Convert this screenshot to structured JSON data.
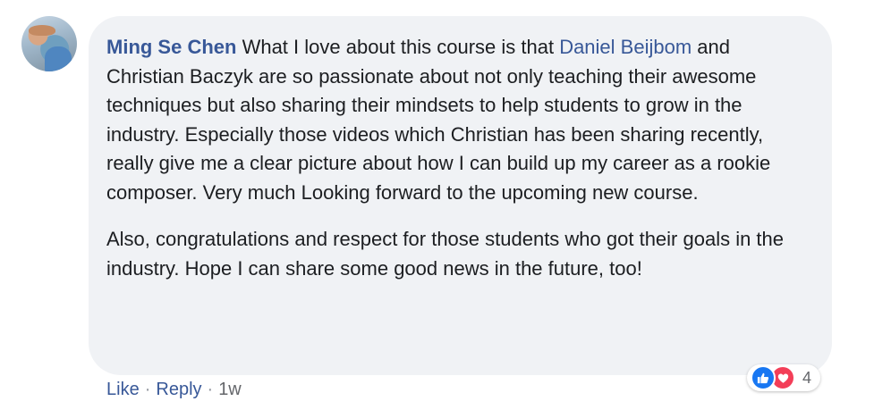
{
  "comment": {
    "author": "Ming Se Chen",
    "para1_intro": " What I love about this course is that ",
    "mention": "Daniel Beijbom",
    "para1_rest": " and Christian Baczyk are so passionate about not only teaching their awesome techniques but also sharing their mindsets to help students to grow in the industry. Especially those videos which Christian has been sharing recently, really give me a clear picture about how I can build up my career as a rookie composer. Very much Looking forward to the upcoming new course.",
    "para2": "Also, congratulations and respect for those students who got their goals in the industry. Hope I can share some good news in the future, too!"
  },
  "reactions": {
    "icons": [
      "like-icon",
      "love-icon"
    ],
    "count": "4",
    "colors": {
      "like": "#1877f2",
      "love": "#f33e58"
    }
  },
  "actions": {
    "like_label": "Like",
    "separator": "·",
    "reply_label": "Reply",
    "time": "1w"
  },
  "colors": {
    "link": "#385898",
    "bubble": "#f0f2f5",
    "text": "#1c1e21",
    "meta": "#65676b"
  }
}
